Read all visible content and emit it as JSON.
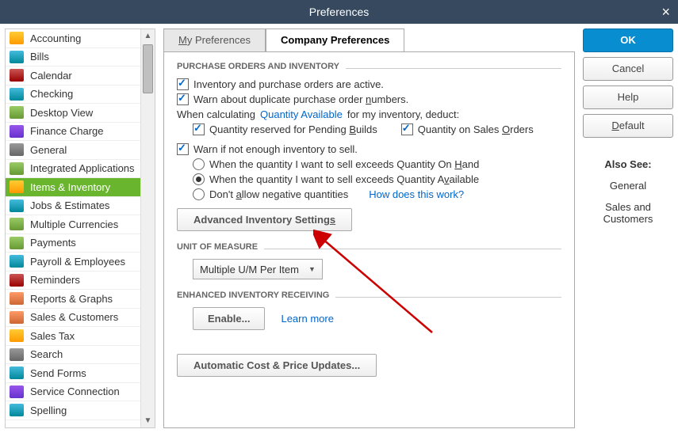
{
  "title": "Preferences",
  "sidebar": [
    {
      "label": "Accounting",
      "ic": "iA"
    },
    {
      "label": "Bills",
      "ic": "iB"
    },
    {
      "label": "Calendar",
      "ic": "iC"
    },
    {
      "label": "Checking",
      "ic": "iB"
    },
    {
      "label": "Desktop View",
      "ic": "iD"
    },
    {
      "label": "Finance Charge",
      "ic": "iE"
    },
    {
      "label": "General",
      "ic": "iF"
    },
    {
      "label": "Integrated Applications",
      "ic": "iD"
    },
    {
      "label": "Items & Inventory",
      "ic": "iA",
      "sel": true
    },
    {
      "label": "Jobs & Estimates",
      "ic": "iB"
    },
    {
      "label": "Multiple Currencies",
      "ic": "iD"
    },
    {
      "label": "Payments",
      "ic": "iD"
    },
    {
      "label": "Payroll & Employees",
      "ic": "iB"
    },
    {
      "label": "Reminders",
      "ic": "iC"
    },
    {
      "label": "Reports & Graphs",
      "ic": "iG"
    },
    {
      "label": "Sales & Customers",
      "ic": "iG"
    },
    {
      "label": "Sales Tax",
      "ic": "iA"
    },
    {
      "label": "Search",
      "ic": "iF"
    },
    {
      "label": "Send Forms",
      "ic": "iB"
    },
    {
      "label": "Service Connection",
      "ic": "iE"
    },
    {
      "label": "Spelling",
      "ic": "iB"
    }
  ],
  "tabs": {
    "my": "y Preferences",
    "company": "Company Preferences"
  },
  "sect1": {
    "title": "PURCHASE ORDERS AND INVENTORY",
    "c1": "Inventory and purchase orders are active.",
    "c2_a": "Warn about duplicate purchase order ",
    "c2_u": "n",
    "c2_b": "umbers.",
    "deduct_a": "When calculating",
    "deduct_link": "Quantity Available",
    "deduct_b": "for my inventory, deduct:",
    "cb_a": "Quantity reserved for Pending ",
    "cb_u": "B",
    "cb_b": "uilds",
    "cs_a": "Quantity on Sales ",
    "cs_u": "O",
    "cs_b": "rders",
    "c3": "Warn if not enough inventory to sell.",
    "r1_a": "When the quantity I want to sell exceeds Quantity On ",
    "r1_u": "H",
    "r1_b": "and",
    "r2_a": "When the quantity I want to sell exceeds Quantity A",
    "r2_u": "v",
    "r2_b": "ailable",
    "r3_a": "Don't ",
    "r3_u": "a",
    "r3_b": "llow negative quantities",
    "how": "How does this work?",
    "adv_a": "Advanced Inventory Setting",
    "adv_u": "s"
  },
  "sect2": {
    "title": "UNIT OF MEASURE",
    "select": "Multiple U/M Per Item"
  },
  "sect3": {
    "title": "ENHANCED INVENTORY RECEIVING",
    "enable": "Enable...",
    "learn": "Learn more"
  },
  "auto": "Automatic Cost & Price Updates...",
  "right": {
    "ok": "OK",
    "cancel": "Cancel",
    "help": "Help",
    "default_u": "D",
    "default_b": "efault"
  },
  "also": {
    "title": "Also See:",
    "i1": "General",
    "i2": "Sales and Customers"
  }
}
